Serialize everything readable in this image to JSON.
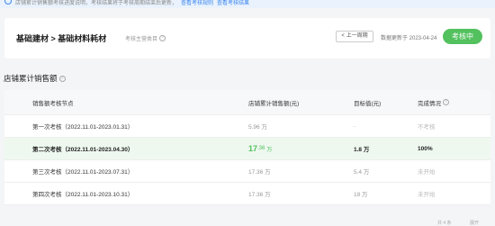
{
  "notice": {
    "text": "店铺累计销售额考核进度说明，考核结果将于考核周期结束后更新，",
    "link1": "查看考核规则",
    "link2": "查看考核结果"
  },
  "header": {
    "title": "基础建材 > 基础材料耗材",
    "subtitle": "考核主营类目",
    "prev_label": "< 上一周期",
    "update_label": "数据更新于 2023-04-24",
    "status_label": "考核中"
  },
  "section": {
    "title": "店铺累计销售额"
  },
  "table": {
    "headers": [
      "销售额考核节点",
      "店铺累计销售额(元)",
      "目标值(元)",
      "完成情况"
    ],
    "rows": [
      {
        "node": "第一次考核（2022.11.01-2023.01.31）",
        "sales": "5.96 万",
        "target": "-",
        "status": "不考核"
      },
      {
        "node": "第二次考核（2022.11.01-2023.04.30）",
        "sales_value": "17",
        "sales_decimal": ".36",
        "sales_unit": "万",
        "target": "1.8 万",
        "status": "100%"
      },
      {
        "node": "第三次考核（2022.11.01-2023.07.31）",
        "sales": "17.36 万",
        "target": "5.4 万",
        "status": "未开始"
      },
      {
        "node": "第四次考核（2022.11.01-2023.10.31）",
        "sales": "17.36 万",
        "target": "18 万",
        "status": "未开始"
      }
    ]
  },
  "footer": {
    "left": "共 4 条",
    "right": "展开"
  }
}
